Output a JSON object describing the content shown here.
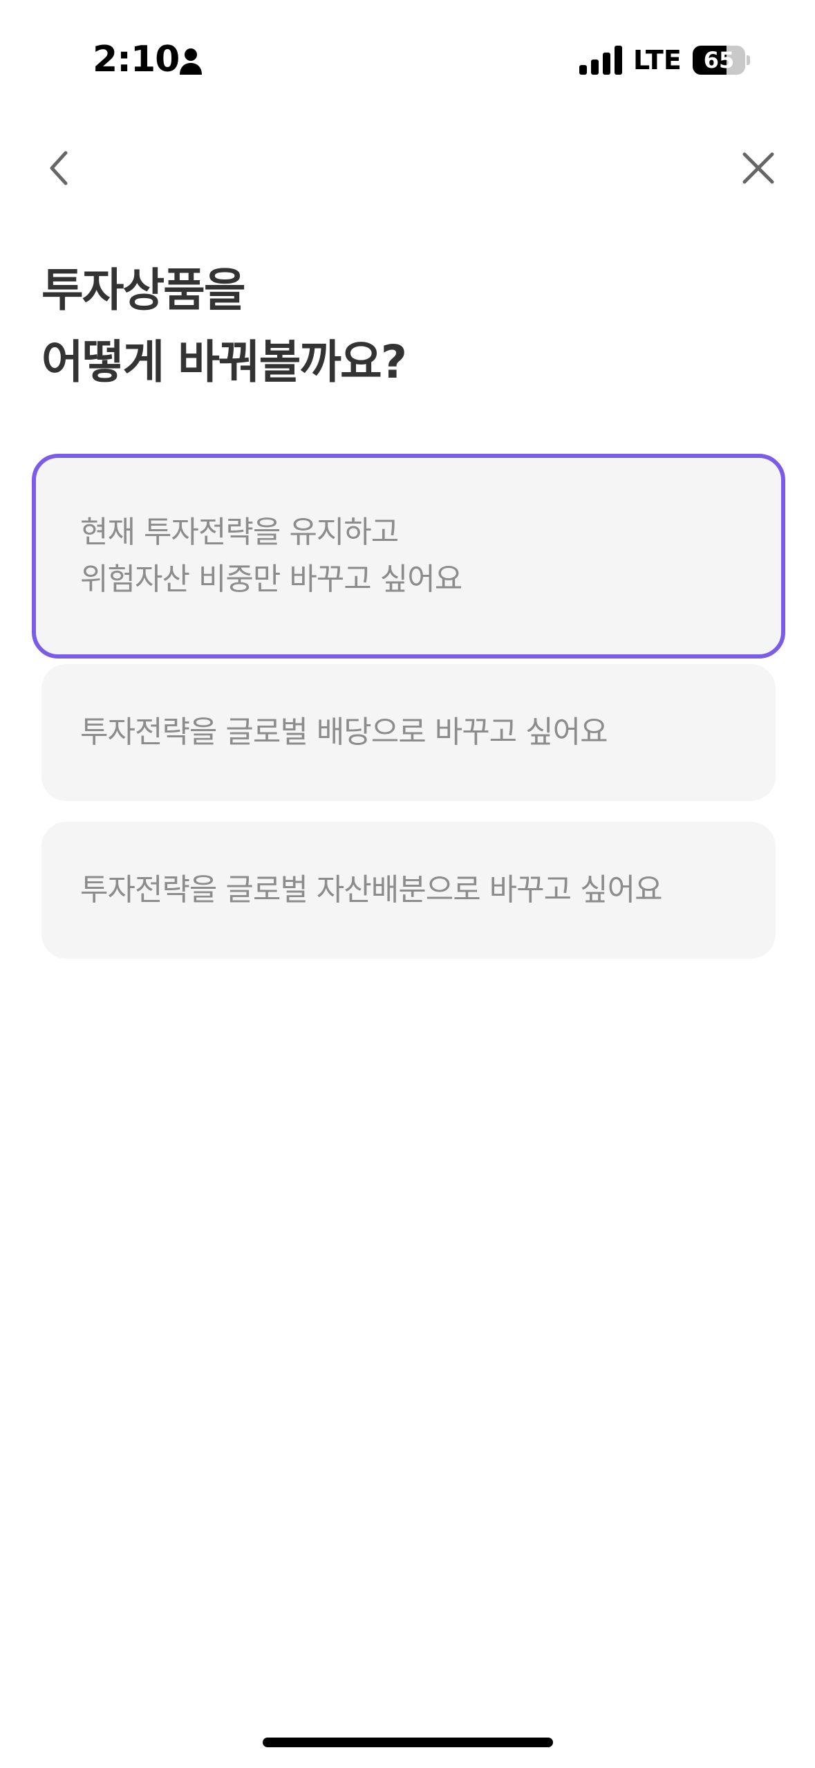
{
  "status_bar": {
    "time": "2:10",
    "network": "LTE",
    "battery": "65",
    "battery_level": 0.65,
    "icons": [
      "person-icon",
      "signal-icon",
      "battery-icon"
    ]
  },
  "nav": {
    "back_icon": "chevron-left-icon",
    "close_icon": "close-icon"
  },
  "title": {
    "line1": "투자상품을",
    "line2": "어떻게 바꿔볼까요?"
  },
  "options": [
    {
      "line1": "현재 투자전략을 유지하고",
      "line2": "위험자산 비중만 바꾸고 싶어요",
      "selected": true
    },
    {
      "line1": "투자전략을 글로벌 배당으로 바꾸고 싶어요",
      "selected": false
    },
    {
      "line1": "투자전략을 글로벌 자산배분으로 바꾸고 싶어요",
      "selected": false
    }
  ],
  "colors": {
    "accent": "#7b5ce8",
    "card_background": "#f5f5f5",
    "option_text": "#8c8c8c",
    "title_text": "#333333"
  }
}
